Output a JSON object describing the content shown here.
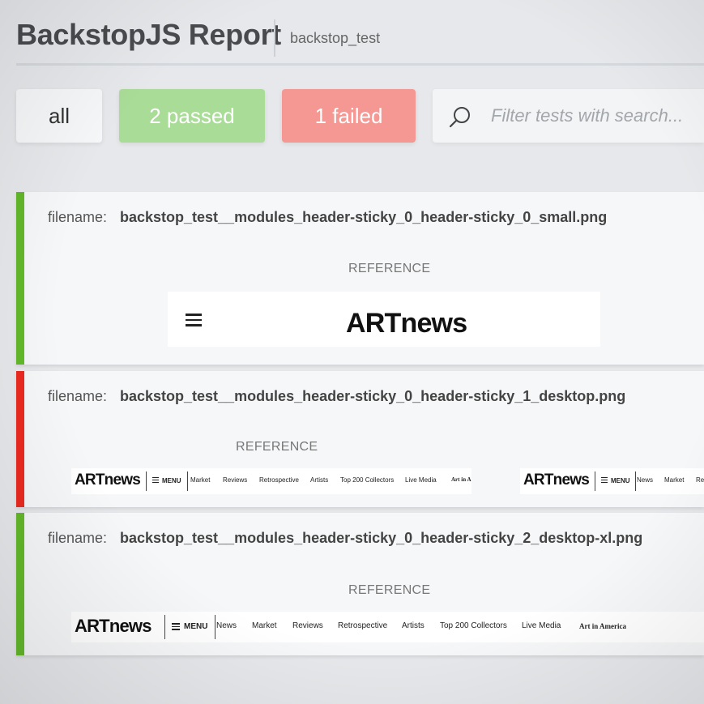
{
  "header": {
    "title": "BackstopJS Report",
    "project": "backstop_test"
  },
  "filters": {
    "all_label": "all",
    "passed_label": "2 passed",
    "failed_label": "1 failed",
    "search_placeholder": "Filter tests with search..."
  },
  "colors": {
    "pass": "#63b82a",
    "fail": "#ea2a20",
    "passed_button": "#a9dc97",
    "failed_button": "#f59893"
  },
  "tests": [
    {
      "status": "pass",
      "filename_label": "filename:",
      "filename": "backstop_test__modules_header-sticky_0_header-sticky_0_small.png",
      "reference_label": "REFERENCE",
      "screenshot": {
        "logo": "ARTnews",
        "icon": "hamburger-menu-icon"
      }
    },
    {
      "status": "fail",
      "filename_label": "filename:",
      "filename": "backstop_test__modules_header-sticky_0_header-sticky_1_desktop.png",
      "reference_label": "REFERENCE",
      "screenshot_reference": {
        "logo": "ARTnews",
        "menu": "MENU",
        "nav": [
          "Market",
          "Reviews",
          "Retrospective",
          "Artists",
          "Top 200 Collectors",
          "Live Media"
        ],
        "extra": "Art in A"
      },
      "screenshot_test": {
        "logo": "ARTnews",
        "menu": "MENU",
        "nav": [
          "News",
          "Market",
          "Re"
        ]
      }
    },
    {
      "status": "pass",
      "filename_label": "filename:",
      "filename": "backstop_test__modules_header-sticky_0_header-sticky_2_desktop-xl.png",
      "reference_label": "REFERENCE",
      "screenshot": {
        "logo": "ARTnews",
        "menu": "MENU",
        "nav": [
          "News",
          "Market",
          "Reviews",
          "Retrospective",
          "Artists",
          "Top 200 Collectors",
          "Live Media"
        ],
        "extra": "Art in America"
      }
    }
  ]
}
